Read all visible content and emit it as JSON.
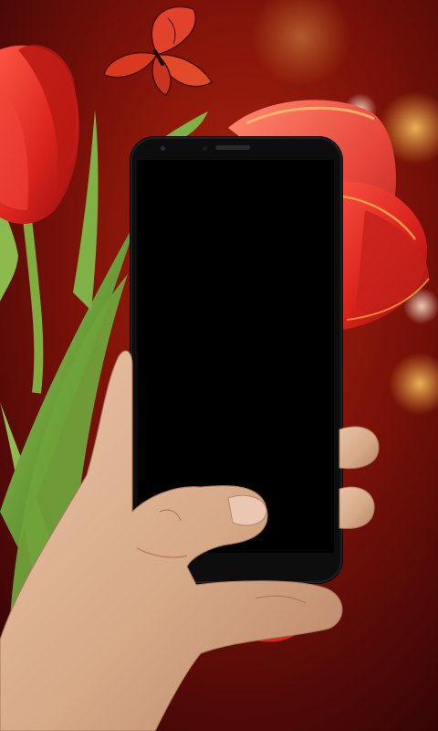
{
  "scene": {
    "background_colors": {
      "deep": "#2a0306",
      "mid": "#8a140c",
      "warm": "#c9390f",
      "bokeh": "#f2a93b"
    },
    "subjects": [
      "butterfly-icon",
      "tulip-icon",
      "hand-icon",
      "smartphone-icon"
    ],
    "flower_color": "#e22a22",
    "leaf_color": "#6fa23a",
    "skin_color": "#d9ad8c",
    "phone_color": "#0d0d0d"
  }
}
